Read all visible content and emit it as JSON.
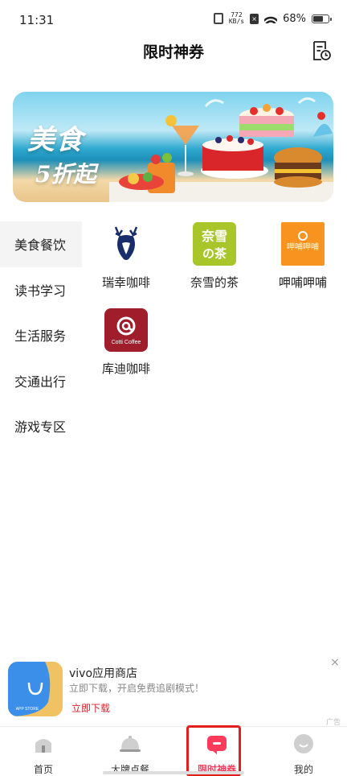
{
  "status_bar": {
    "time": "11:31",
    "net_speed_value": "772",
    "net_speed_unit": "KB/s",
    "battery_percent": "68%",
    "battery_level": 0.68
  },
  "header": {
    "title": "限时神券",
    "history_icon": "coupon-history-icon"
  },
  "banner": {
    "line1": "美食",
    "line2": "5折起"
  },
  "categories": [
    {
      "label": "美食餐饮",
      "active": true
    },
    {
      "label": "读书学习",
      "active": false
    },
    {
      "label": "生活服务",
      "active": false
    },
    {
      "label": "交通出行",
      "active": false
    },
    {
      "label": "游戏专区",
      "active": false
    }
  ],
  "brands": [
    {
      "name": "瑞幸咖啡",
      "logo_color": "#ffffff",
      "accent": "#1a2d6b"
    },
    {
      "name": "奈雪的茶",
      "logo_color": "#a8c62a",
      "logo_text": "奈雪の茶"
    },
    {
      "name": "呷哺呷哺",
      "logo_color": "#f7931e",
      "logo_text": "呷哺呷哺"
    },
    {
      "name": "库迪咖啡",
      "logo_color": "#a01d2c",
      "logo_text": "Cotti Coffee"
    }
  ],
  "ad": {
    "title": "vivo应用商店",
    "subtitle": "立即下载，开启免费追剧模式！",
    "cta": "立即下载",
    "icon_text": "APP STORE",
    "tag": "广告",
    "close": "×"
  },
  "nav": [
    {
      "label": "首页",
      "icon": "home-icon",
      "active": false
    },
    {
      "label": "大牌点餐",
      "icon": "dish-cover-icon",
      "active": false
    },
    {
      "label": "限时神券",
      "icon": "coupon-icon",
      "active": true
    },
    {
      "label": "我的",
      "icon": "profile-face-icon",
      "active": false
    }
  ],
  "colors": {
    "accent": "#ff3b5c",
    "highlight_box": "#e0201c",
    "active_category_bg": "#f4f4f4"
  }
}
